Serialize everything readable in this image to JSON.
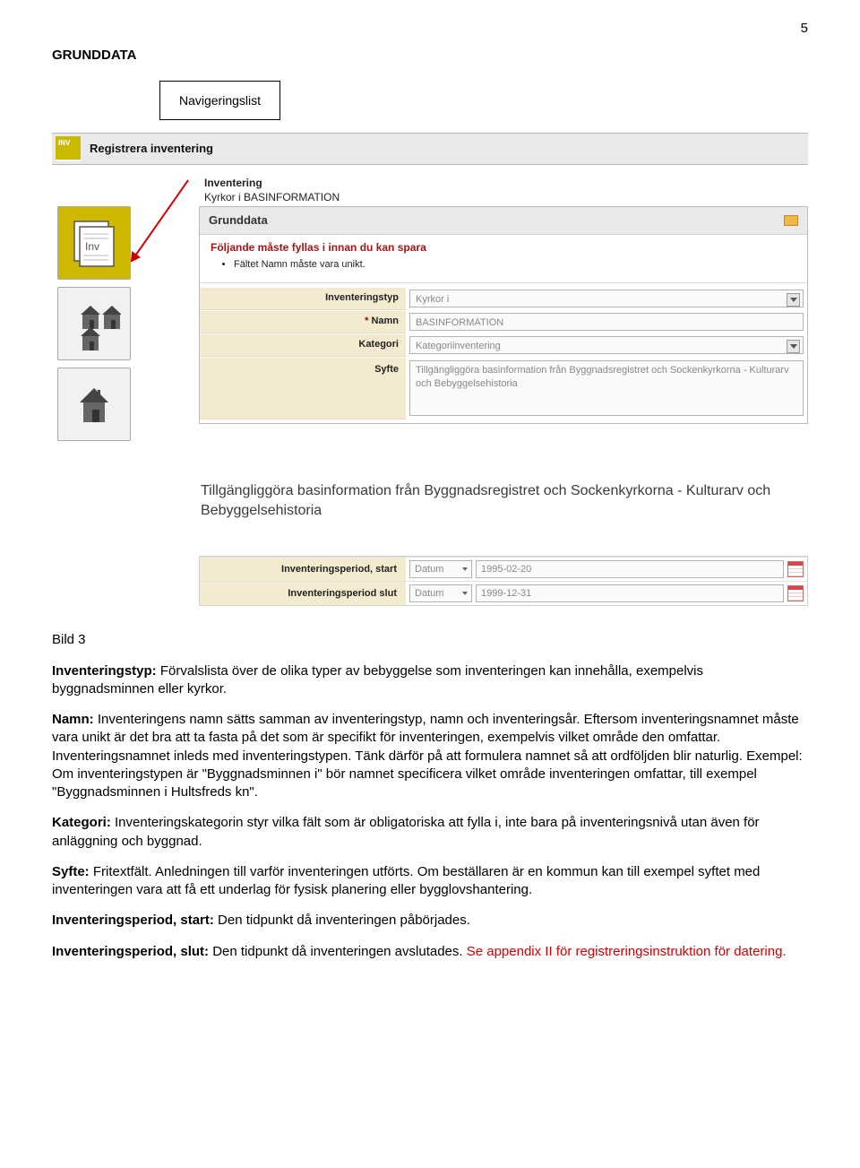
{
  "page_number": "5",
  "section_title": "GRUNDDATA",
  "callout_label": "Navigeringslist",
  "top_bar": {
    "inv_badge": "INV",
    "title": "Registrera inventering"
  },
  "inv_heading": {
    "title": "Inventering",
    "subtitle": "Kyrkor i BASINFORMATION"
  },
  "panel": {
    "heading": "Grunddata",
    "warn_title": "Följande måste fyllas i innan du kan spara",
    "warn_items": [
      "Fältet Namn måste vara unikt."
    ],
    "fields": {
      "inventeringstyp": {
        "label": "Inventeringstyp",
        "value": "Kyrkor i"
      },
      "namn": {
        "label": "Namn",
        "required": "*",
        "value": "BASINFORMATION"
      },
      "kategori": {
        "label": "Kategori",
        "value": "Kategoriinventering"
      },
      "syfte": {
        "label": "Syfte",
        "value": "Tillgängliggöra basinformation från Byggnadsregistret och Sockenkyrkorna - Kulturarv och Bebyggelsehistoria"
      }
    }
  },
  "syfte_large": "Tillgängliggöra basinformation från Byggnadsregistret och Sockenkyrkorna - Kulturarv och Bebyggelsehistoria",
  "dates": {
    "start": {
      "label": "Inventeringsperiod, start",
      "mode": "Datum",
      "value": "1995-02-20"
    },
    "slut": {
      "label": "Inventeringsperiod slut",
      "mode": "Datum",
      "value": "1999-12-31"
    }
  },
  "body": {
    "bild": "Bild 3",
    "inventeringstyp_lead": "Inventeringstyp:",
    "inventeringstyp_text": " Förvalslista över de olika typer av bebyggelse som inventeringen kan innehålla, exempelvis byggnadsminnen eller kyrkor.",
    "namn_lead": "Namn:",
    "namn_text": " Inventeringens namn sätts samman av inventeringstyp, namn och inventeringsår. Eftersom inventeringsnamnet måste vara unikt är det bra att ta fasta på det som är specifikt för inventeringen, exempelvis vilket område den omfattar. Inventeringsnamnet inleds med inventeringstypen. Tänk därför på att formulera namnet så att ordföljden blir naturlig. Exempel: Om inventeringstypen är \"Byggnadsminnen i\" bör namnet specificera vilket område inventeringen omfattar, till exempel \"Byggnadsminnen i Hultsfreds kn\".",
    "kategori_lead": "Kategori:",
    "kategori_text": " Inventeringskategorin styr vilka fält som är obligatoriska att fylla i, inte bara på inventeringsnivå utan även för anläggning och byggnad.",
    "syfte_lead": "Syfte:",
    "syfte_text": " Fritextfält. Anledningen till varför inventeringen utförts. Om beställaren är en kommun kan till exempel syftet med inventeringen vara att få ett underlag för fysisk planering eller bygglovshantering.",
    "start_lead": "Inventeringsperiod, start:",
    "start_text": " Den tidpunkt då inventeringen påbörjades.",
    "slut_lead": "Inventeringsperiod, slut:",
    "slut_text1": " Den tidpunkt då inventeringen avslutades. ",
    "slut_red": "Se appendix II för registreringsinstruktion för datering."
  }
}
